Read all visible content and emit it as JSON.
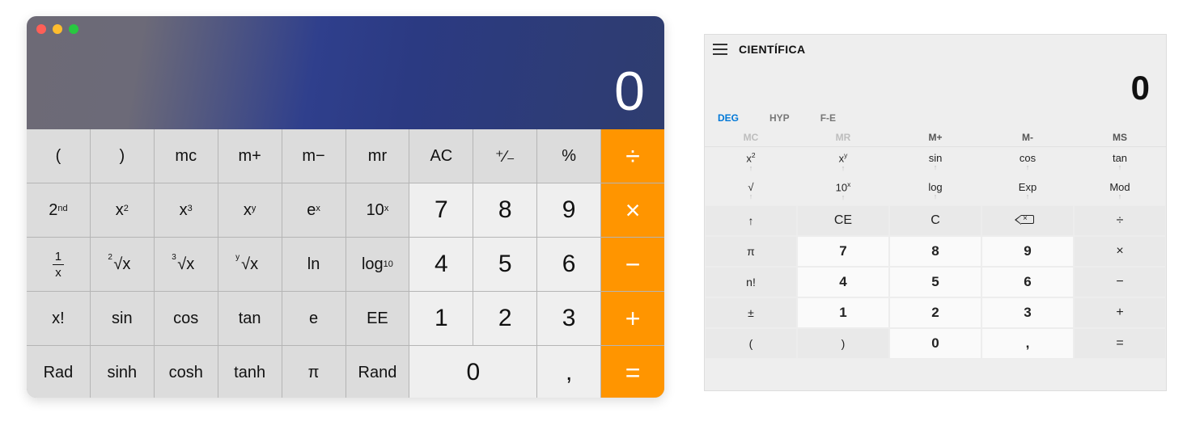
{
  "mac": {
    "display_value": "0",
    "rows": [
      [
        {
          "label": "(",
          "type": "fn",
          "name": "paren-open"
        },
        {
          "label": ")",
          "type": "fn",
          "name": "paren-close"
        },
        {
          "label": "mc",
          "type": "fn",
          "name": "memory-clear"
        },
        {
          "label": "m+",
          "type": "fn",
          "name": "memory-add"
        },
        {
          "label": "m−",
          "type": "fn",
          "name": "memory-sub"
        },
        {
          "label": "mr",
          "type": "fn",
          "name": "memory-recall"
        },
        {
          "label": "AC",
          "type": "fn",
          "name": "all-clear"
        },
        {
          "label": "⁺∕₋",
          "type": "fn",
          "name": "sign-toggle"
        },
        {
          "label": "%",
          "type": "fn",
          "name": "percent"
        },
        {
          "label": "÷",
          "type": "op",
          "name": "divide"
        }
      ],
      [
        {
          "label": "2",
          "sup": "nd",
          "type": "fn",
          "name": "second"
        },
        {
          "label": "x",
          "sup": "2",
          "type": "fn",
          "name": "square"
        },
        {
          "label": "x",
          "sup": "3",
          "type": "fn",
          "name": "cube"
        },
        {
          "label": "x",
          "sup": "y",
          "type": "fn",
          "name": "power"
        },
        {
          "label": "e",
          "sup": "x",
          "type": "fn",
          "name": "exp"
        },
        {
          "label": "10",
          "sup": "x",
          "type": "fn",
          "name": "ten-power"
        },
        {
          "label": "7",
          "type": "digit",
          "name": "digit-7"
        },
        {
          "label": "8",
          "type": "digit",
          "name": "digit-8"
        },
        {
          "label": "9",
          "type": "digit",
          "name": "digit-9"
        },
        {
          "label": "×",
          "type": "op",
          "name": "multiply"
        }
      ],
      [
        {
          "frac_top": "1",
          "frac_bot": "x",
          "type": "fn",
          "name": "reciprocal"
        },
        {
          "root_idx": "2",
          "root_base": "x",
          "type": "fn",
          "name": "sqrt"
        },
        {
          "root_idx": "3",
          "root_base": "x",
          "type": "fn",
          "name": "cbrt"
        },
        {
          "root_idx": "y",
          "root_base": "x",
          "type": "fn",
          "name": "nthroot"
        },
        {
          "label": "ln",
          "type": "fn",
          "name": "ln"
        },
        {
          "label": "log",
          "sub": "10",
          "type": "fn",
          "name": "log10"
        },
        {
          "label": "4",
          "type": "digit",
          "name": "digit-4"
        },
        {
          "label": "5",
          "type": "digit",
          "name": "digit-5"
        },
        {
          "label": "6",
          "type": "digit",
          "name": "digit-6"
        },
        {
          "label": "−",
          "type": "op",
          "name": "subtract"
        }
      ],
      [
        {
          "label": "x!",
          "type": "fn",
          "name": "factorial"
        },
        {
          "label": "sin",
          "type": "fn",
          "name": "sin"
        },
        {
          "label": "cos",
          "type": "fn",
          "name": "cos"
        },
        {
          "label": "tan",
          "type": "fn",
          "name": "tan"
        },
        {
          "label": "e",
          "type": "fn",
          "name": "e-const"
        },
        {
          "label": "EE",
          "type": "fn",
          "name": "ee"
        },
        {
          "label": "1",
          "type": "digit",
          "name": "digit-1"
        },
        {
          "label": "2",
          "type": "digit",
          "name": "digit-2"
        },
        {
          "label": "3",
          "type": "digit",
          "name": "digit-3"
        },
        {
          "label": "+",
          "type": "op",
          "name": "add"
        }
      ],
      [
        {
          "label": "Rad",
          "type": "fn",
          "name": "rad"
        },
        {
          "label": "sinh",
          "type": "fn",
          "name": "sinh"
        },
        {
          "label": "cosh",
          "type": "fn",
          "name": "cosh"
        },
        {
          "label": "tanh",
          "type": "fn",
          "name": "tanh"
        },
        {
          "label": "π",
          "type": "fn",
          "name": "pi"
        },
        {
          "label": "Rand",
          "type": "fn",
          "name": "rand"
        },
        {
          "label": "0",
          "type": "digit",
          "name": "digit-0",
          "span": 2
        },
        {
          "label": ",",
          "type": "digit",
          "name": "decimal"
        },
        {
          "label": "=",
          "type": "op",
          "name": "equals"
        }
      ]
    ]
  },
  "win": {
    "title": "CIENTÍFICA",
    "display_value": "0",
    "modes": [
      {
        "label": "DEG",
        "active": true
      },
      {
        "label": "HYP",
        "active": false
      },
      {
        "label": "F-E",
        "active": false
      }
    ],
    "memory": [
      {
        "label": "MC",
        "enabled": false
      },
      {
        "label": "MR",
        "enabled": false
      },
      {
        "label": "M+",
        "enabled": true
      },
      {
        "label": "M-",
        "enabled": true
      },
      {
        "label": "MS",
        "enabled": true
      }
    ],
    "funcRowA": [
      {
        "base": "x",
        "sup": "2",
        "name": "square"
      },
      {
        "base": "x",
        "sup": "y",
        "name": "power"
      },
      {
        "label": "sin",
        "name": "sin"
      },
      {
        "label": "cos",
        "name": "cos"
      },
      {
        "label": "tan",
        "name": "tan"
      }
    ],
    "funcRowB": [
      {
        "label": "√",
        "name": "sqrt"
      },
      {
        "base": "10",
        "sup": "x",
        "name": "ten-power"
      },
      {
        "label": "log",
        "name": "log"
      },
      {
        "label": "Exp",
        "name": "exp"
      },
      {
        "label": "Mod",
        "name": "mod"
      }
    ],
    "main": [
      [
        {
          "label": "↑",
          "type": "sci",
          "name": "shift"
        },
        {
          "label": "CE",
          "type": "light",
          "name": "ce"
        },
        {
          "label": "C",
          "type": "light",
          "name": "c"
        },
        {
          "icon": "backspace",
          "type": "light",
          "name": "backspace"
        },
        {
          "label": "÷",
          "type": "light",
          "name": "divide"
        }
      ],
      [
        {
          "label": "π",
          "type": "sci",
          "name": "pi"
        },
        {
          "label": "7",
          "type": "num",
          "name": "digit-7"
        },
        {
          "label": "8",
          "type": "num",
          "name": "digit-8"
        },
        {
          "label": "9",
          "type": "num",
          "name": "digit-9"
        },
        {
          "label": "×",
          "type": "light",
          "name": "multiply"
        }
      ],
      [
        {
          "label": "n!",
          "type": "sci",
          "name": "factorial"
        },
        {
          "label": "4",
          "type": "num",
          "name": "digit-4"
        },
        {
          "label": "5",
          "type": "num",
          "name": "digit-5"
        },
        {
          "label": "6",
          "type": "num",
          "name": "digit-6"
        },
        {
          "label": "−",
          "type": "light",
          "name": "subtract"
        }
      ],
      [
        {
          "label": "±",
          "type": "sci",
          "name": "sign"
        },
        {
          "label": "1",
          "type": "num",
          "name": "digit-1"
        },
        {
          "label": "2",
          "type": "num",
          "name": "digit-2"
        },
        {
          "label": "3",
          "type": "num",
          "name": "digit-3"
        },
        {
          "label": "+",
          "type": "light",
          "name": "add"
        }
      ],
      [
        {
          "label": "(",
          "type": "sci",
          "name": "paren-open"
        },
        {
          "label": ")",
          "type": "sci",
          "name": "paren-close"
        },
        {
          "label": "0",
          "type": "num",
          "name": "digit-0"
        },
        {
          "label": ",",
          "type": "num",
          "name": "decimal"
        },
        {
          "label": "=",
          "type": "light",
          "name": "equals"
        }
      ]
    ]
  }
}
